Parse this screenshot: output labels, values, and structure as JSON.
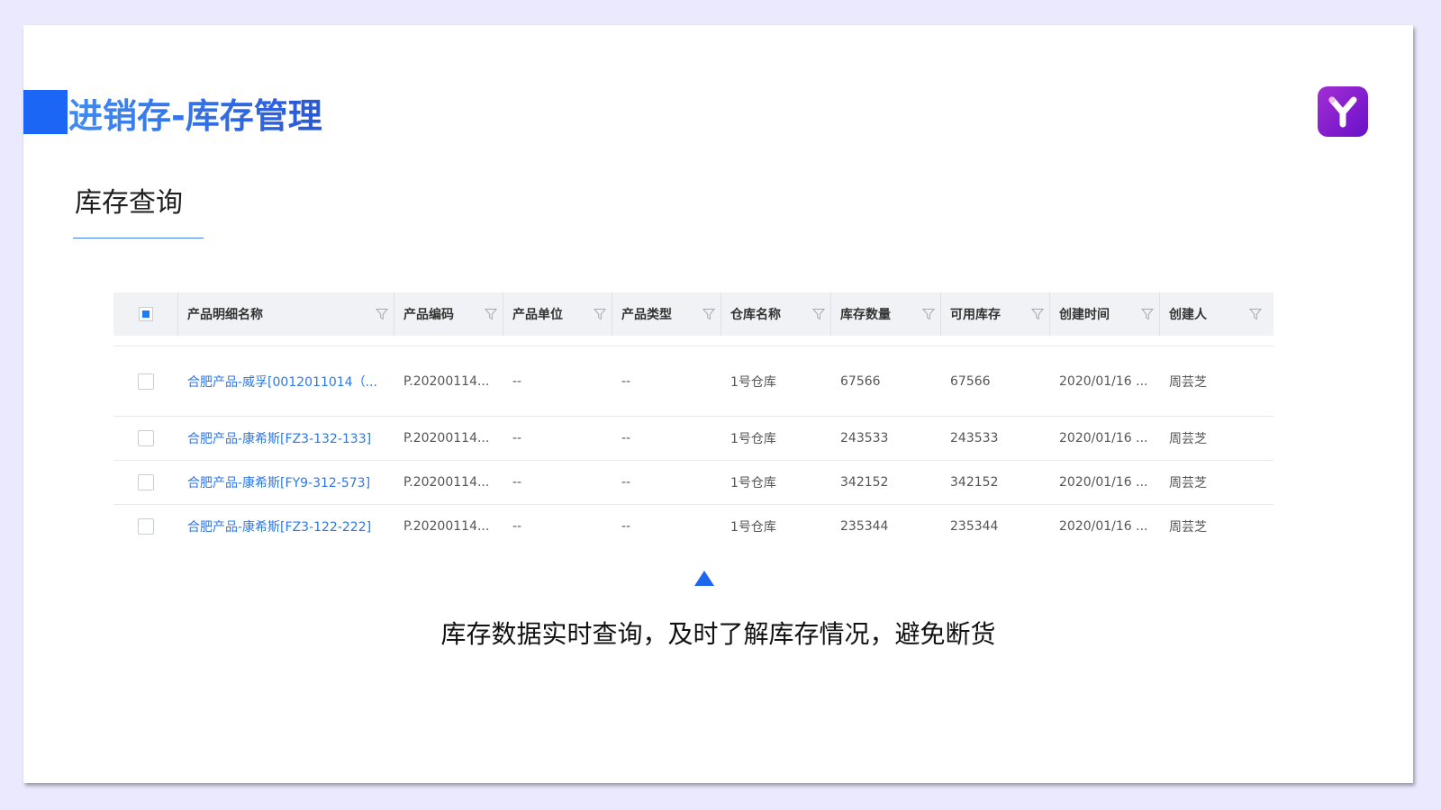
{
  "slide": {
    "title": "进销存-库存管理",
    "subtitle": "库存查询",
    "caption": "库存数据实时查询，及时了解库存情况，避免断货",
    "logo_icon": "y-logo-icon"
  },
  "colors": {
    "accent": "#1c66f5",
    "link": "#2d78e6",
    "logo": "#8a1fd0",
    "background": "#ebe9fd"
  },
  "table": {
    "columns": [
      "产品明细名称",
      "产品编码",
      "产品单位",
      "产品类型",
      "仓库名称",
      "库存数量",
      "可用库存",
      "创建时间",
      "创建人"
    ],
    "rows": [
      [
        "合肥产品-威孚[0012011014（...",
        "P.20200114...",
        "--",
        "--",
        "1号仓库",
        "67566",
        "67566",
        "2020/01/16 ...",
        "周芸芝"
      ],
      [
        "合肥产品-康希斯[FZ3-132-133]",
        "P.20200114...",
        "--",
        "--",
        "1号仓库",
        "243533",
        "243533",
        "2020/01/16 ...",
        "周芸芝"
      ],
      [
        "合肥产品-康希斯[FY9-312-573]",
        "P.20200114...",
        "--",
        "--",
        "1号仓库",
        "342152",
        "342152",
        "2020/01/16 ...",
        "周芸芝"
      ],
      [
        "合肥产品-康希斯[FZ3-122-222]",
        "P.20200114...",
        "--",
        "--",
        "1号仓库",
        "235344",
        "235344",
        "2020/01/16 ...",
        "周芸芝"
      ]
    ]
  }
}
